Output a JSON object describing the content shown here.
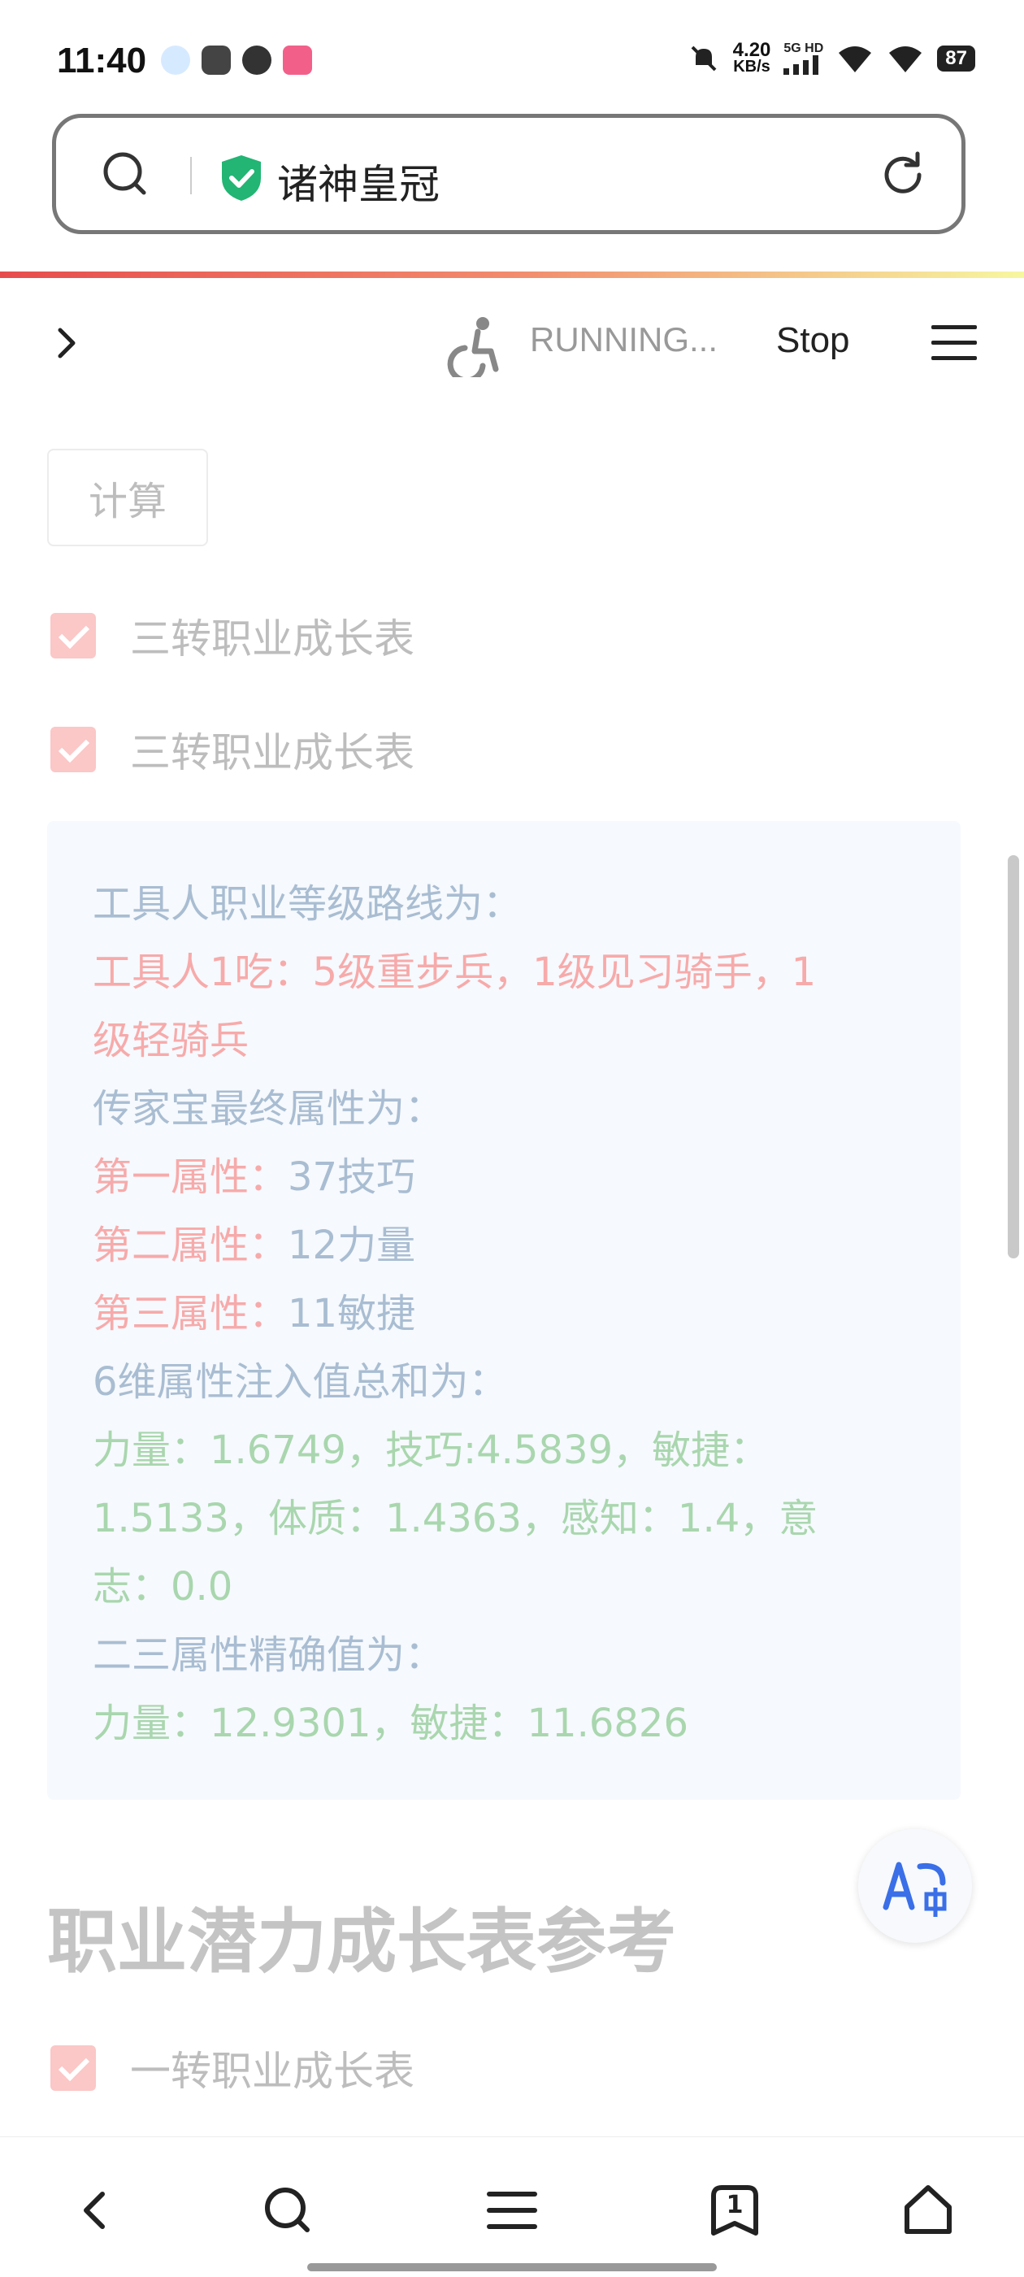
{
  "status_bar": {
    "time": "11:40",
    "net_speed_value": "4.20",
    "net_speed_unit": "KB/s",
    "signal_label": "5G HD",
    "battery": "87"
  },
  "address_bar": {
    "title": "诸神皇冠"
  },
  "toolbar": {
    "status": "RUNNING...",
    "stop_label": "Stop"
  },
  "content": {
    "calculate_button": "计算",
    "checkboxes": [
      {
        "label": "三转职业成长表",
        "checked": true
      },
      {
        "label": "三转职业成长表",
        "checked": true
      }
    ],
    "result": {
      "route_heading": "工具人职业等级路线为：",
      "route_value_line1": "工具人1吃：5级重步兵，1级见习骑手，1",
      "route_value_line2": "级轻骑兵",
      "heirloom_heading": "传家宝最终属性为：",
      "attr1_label": "第一属性：",
      "attr1_value": "37技巧",
      "attr2_label": "第二属性：",
      "attr2_value": "12力量",
      "attr3_label": "第三属性：",
      "attr3_value": "11敏捷",
      "injection_heading": "6维属性注入值总和为：",
      "injection_line1": "力量：1.6749，技巧:4.5839，敏捷：",
      "injection_line2": "1.5133，体质：1.4363，感知：1.4，意",
      "injection_line3": "志：0.0",
      "precise_heading": "二三属性精确值为：",
      "precise_line": "力量：12.9301，敏捷：11.6826"
    },
    "section_heading": "职业潜力成长表参考",
    "section_checkbox": {
      "label": "一转职业成长表",
      "checked": true
    }
  },
  "bottom_nav": {
    "tabs_count": "1"
  },
  "colors": {
    "accent_red": "#e74c4c",
    "checkbox_pink": "#fbc7c7",
    "result_blue": "#a9bdd2",
    "result_pink": "#f7aaaa",
    "result_green": "#a9d6ae"
  }
}
